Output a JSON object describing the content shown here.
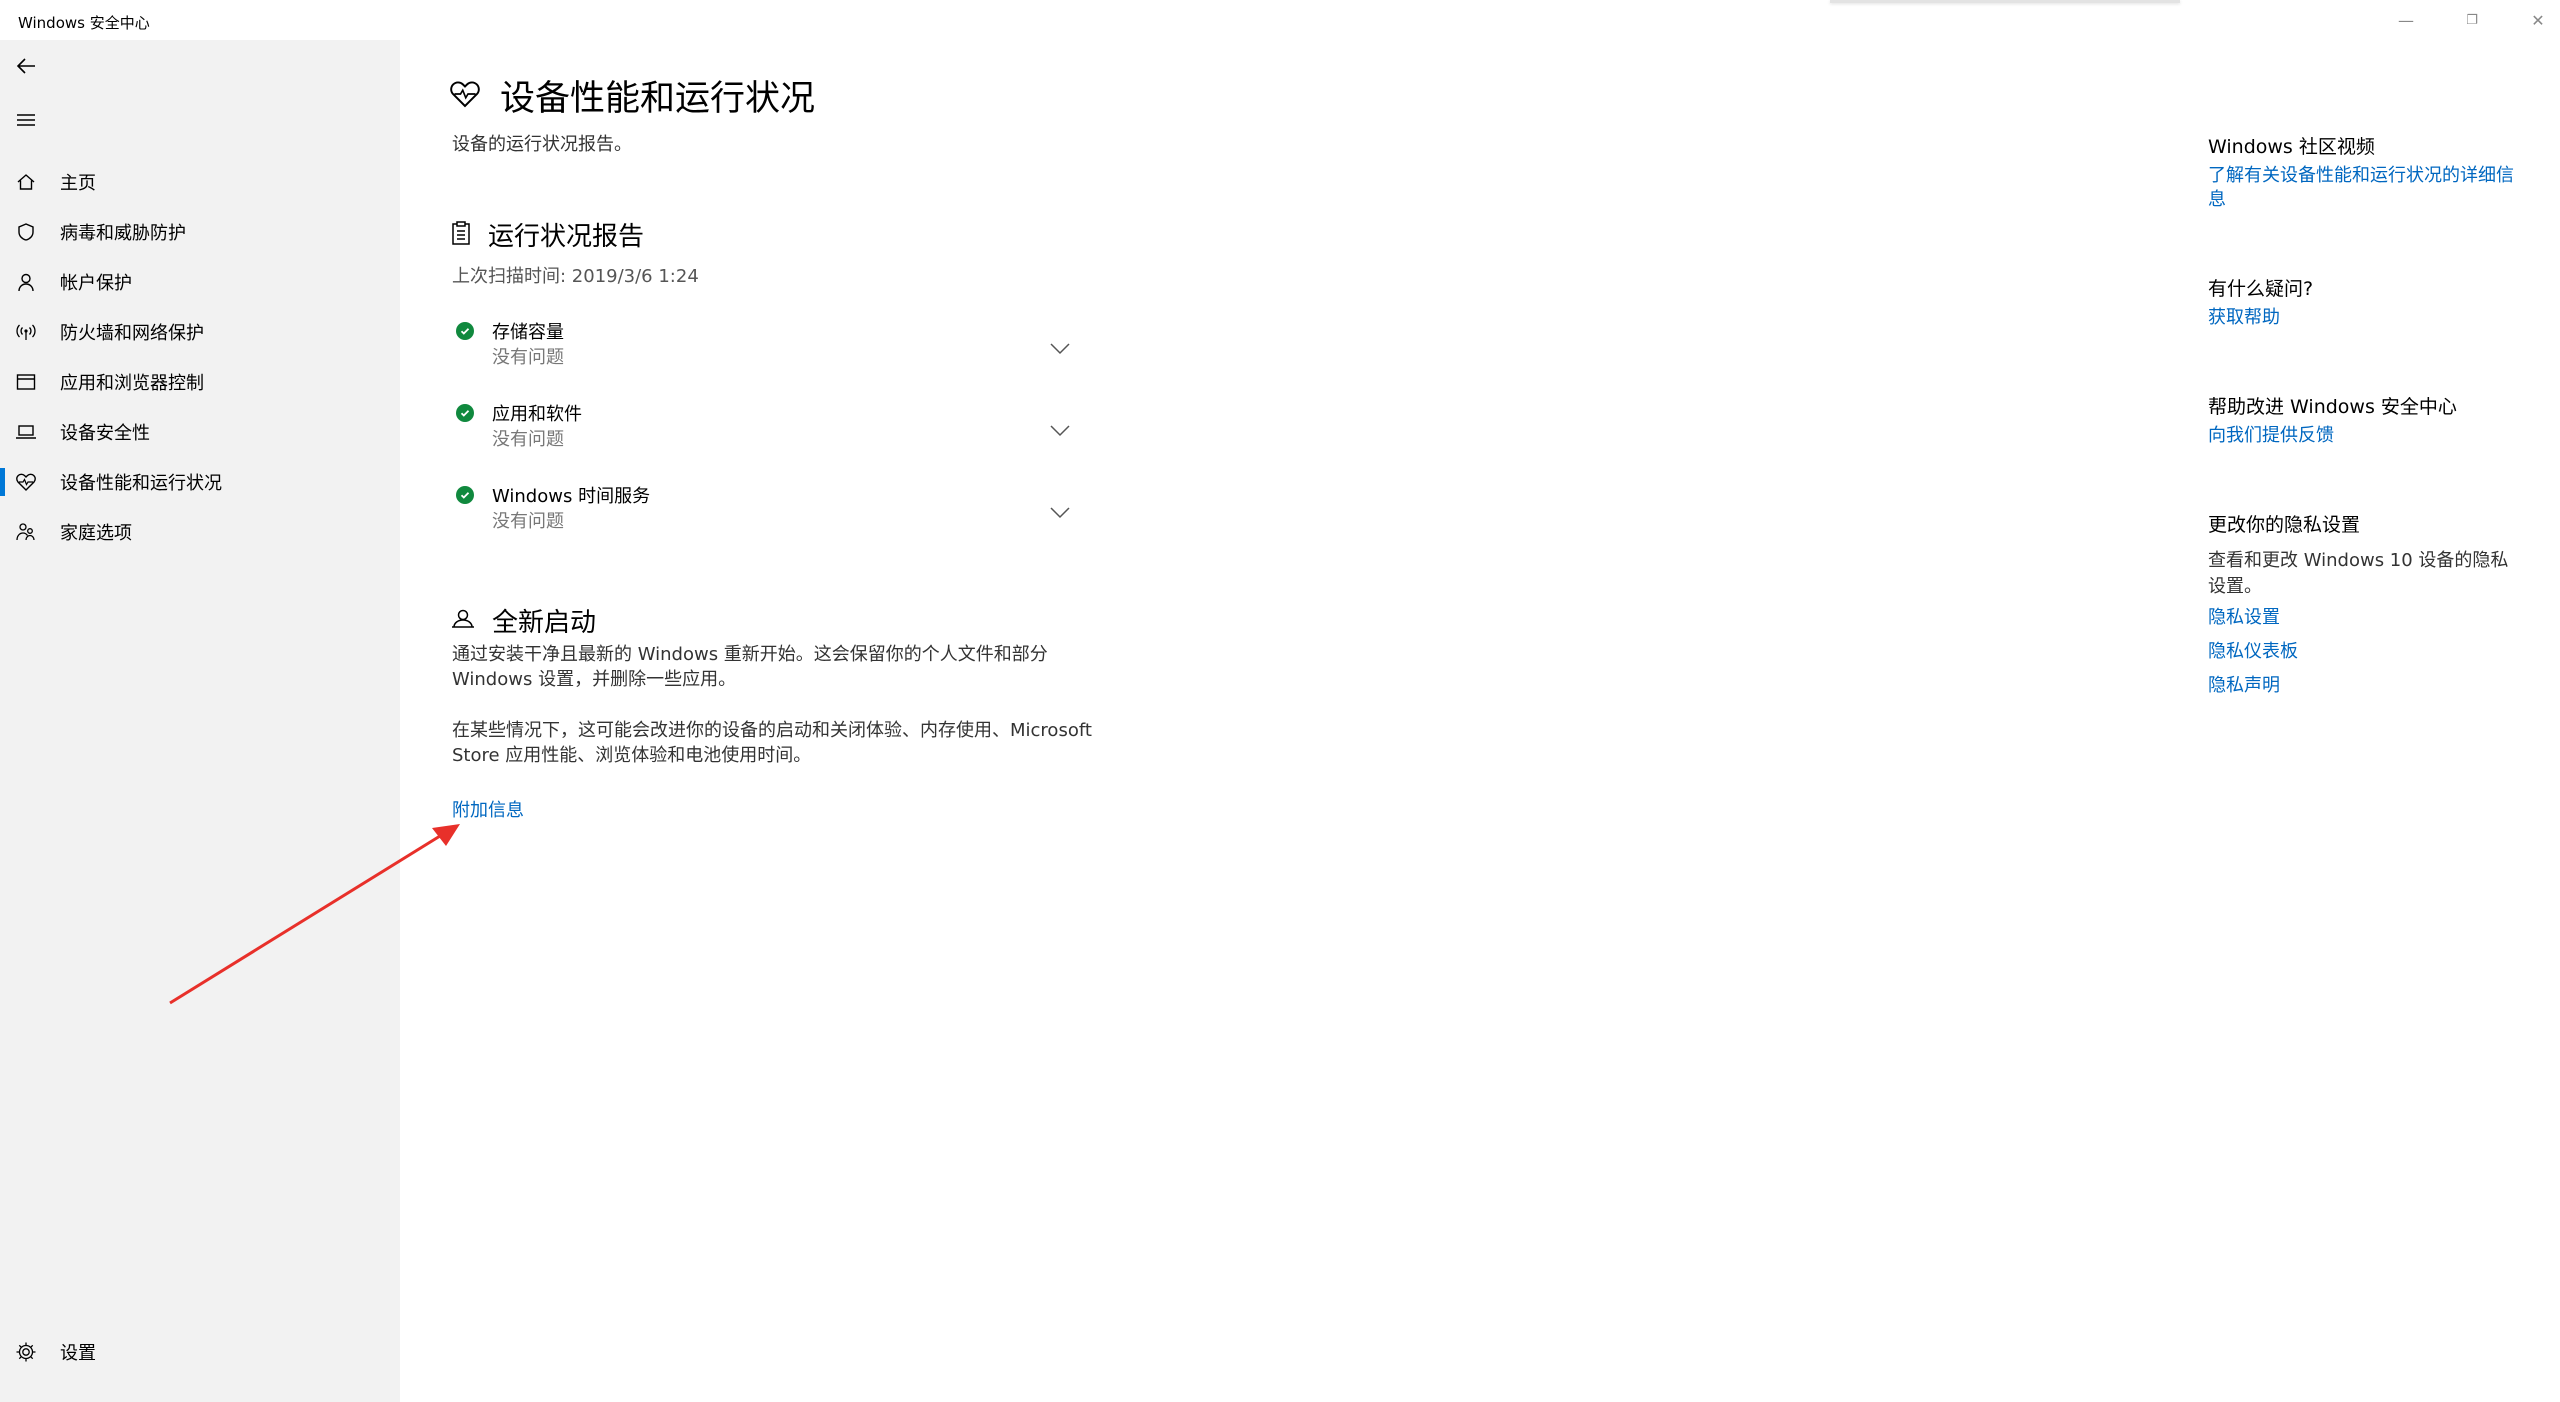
{
  "window": {
    "title": "Windows 安全中心",
    "controls": {
      "minimize": "—",
      "restore": "❐",
      "close": "✕"
    }
  },
  "sidebar": {
    "top_icons": [
      "back-arrow-icon",
      "hamburger-menu-icon"
    ],
    "items": [
      {
        "label": "主页",
        "icon": "home-icon"
      },
      {
        "label": "病毒和威胁防护",
        "icon": "shield-icon"
      },
      {
        "label": "帐户保护",
        "icon": "person-icon"
      },
      {
        "label": "防火墙和网络保护",
        "icon": "wireless-signal-icon"
      },
      {
        "label": "应用和浏览器控制",
        "icon": "browser-window-icon"
      },
      {
        "label": "设备安全性",
        "icon": "laptop-icon"
      },
      {
        "label": "设备性能和运行状况",
        "icon": "heart-pulse-icon",
        "active": true
      },
      {
        "label": "家庭选项",
        "icon": "family-icon"
      }
    ],
    "settings": {
      "label": "设置",
      "icon": "gear-icon"
    }
  },
  "main": {
    "title": "设备性能和运行状况",
    "subtitle": "设备的运行状况报告。",
    "health_report": {
      "title": "运行状况报告",
      "scan_time": "上次扫描时间: 2019/3/6 1:24",
      "items": [
        {
          "name": "存储容量",
          "status": "没有问题"
        },
        {
          "name": "应用和软件",
          "status": "没有问题"
        },
        {
          "name": "Windows 时间服务",
          "status": "没有问题"
        }
      ]
    },
    "fresh_start": {
      "title": "全新启动",
      "para1": "通过安装干净且最新的 Windows 重新开始。这会保留你的个人文件和部分 Windows 设置，并删除一些应用。",
      "para2": "在某些情况下，这可能会改进你的设备的启动和关闭体验、内存使用、Microsoft Store 应用性能、浏览体验和电池使用时间。",
      "link": "附加信息"
    }
  },
  "right_panel": {
    "community": {
      "heading": "Windows 社区视频",
      "link": "了解有关设备性能和运行状况的详细信息"
    },
    "questions": {
      "heading": "有什么疑问?",
      "link": "获取帮助"
    },
    "improve": {
      "heading": "帮助改进 Windows 安全中心",
      "link": "向我们提供反馈"
    },
    "privacy": {
      "heading": "更改你的隐私设置",
      "text": "查看和更改 Windows 10 设备的隐私设置。",
      "links": [
        "隐私设置",
        "隐私仪表板",
        "隐私声明"
      ]
    }
  },
  "colors": {
    "accent": "#0078d7",
    "link": "#0067c0",
    "success": "#10893e",
    "annotation_arrow": "#e8302a"
  }
}
